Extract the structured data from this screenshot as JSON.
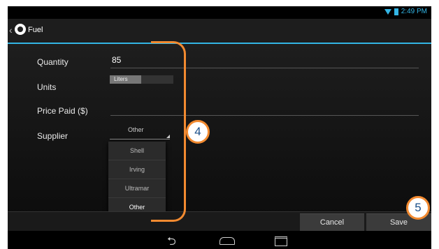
{
  "status_bar": {
    "time": "2:49 PM"
  },
  "action_bar": {
    "title": "Fuel"
  },
  "form": {
    "quantity": {
      "label": "Quantity",
      "value": "85"
    },
    "units": {
      "label": "Units",
      "selected": "Liters"
    },
    "price_paid": {
      "label": "Price Paid ($)",
      "value": ""
    },
    "supplier": {
      "label": "Supplier",
      "selected": "Other"
    }
  },
  "supplier_dropdown": {
    "options": [
      "Shell",
      "Irving",
      "Ultramar",
      "Other"
    ],
    "selected": "Other"
  },
  "buttons": {
    "cancel": "Cancel",
    "save": "Save"
  },
  "callouts": {
    "form_marker": "4",
    "save_marker": "5"
  },
  "colors": {
    "accent": "#33b5e5",
    "annotation": "#f28a30",
    "callout_text": "#1a4f8a"
  }
}
